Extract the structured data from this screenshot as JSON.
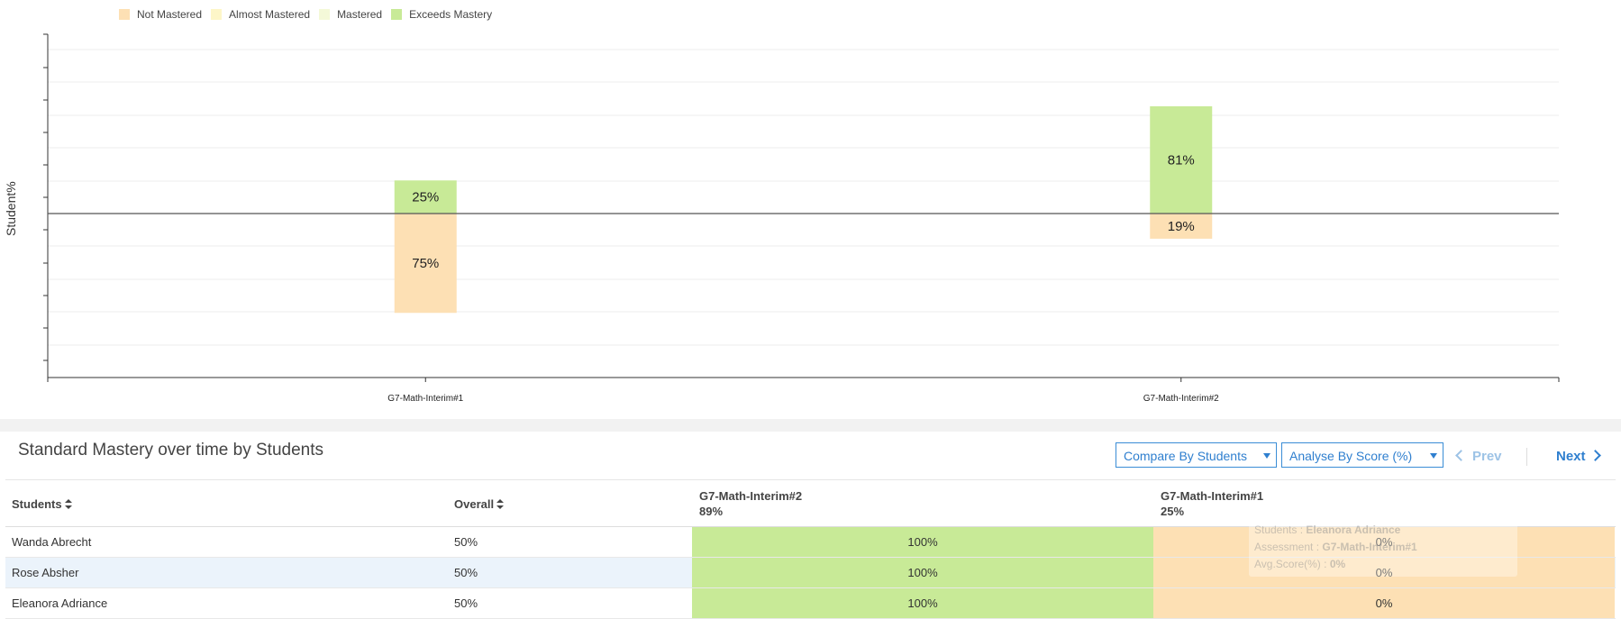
{
  "legend": [
    {
      "label": "Not Mastered",
      "color": "#fde0b4"
    },
    {
      "label": "Almost Mastered",
      "color": "#fdf6c8"
    },
    {
      "label": "Mastered",
      "color": "#f4f9d8"
    },
    {
      "label": "Exceeds Mastery",
      "color": "#c8ea97"
    }
  ],
  "chart_data": {
    "type": "bar",
    "stacked": "diverging",
    "ylabel": "Student%",
    "categories": [
      "G7-Math-Interim#1",
      "G7-Math-Interim#2"
    ],
    "series": [
      {
        "name": "Exceeds Mastery",
        "direction": "up",
        "color": "#c8ea97",
        "values": [
          25,
          81
        ],
        "labels": [
          "25%",
          "81%"
        ]
      },
      {
        "name": "Not Mastered",
        "direction": "down",
        "color": "#fde0b4",
        "values": [
          75,
          19
        ],
        "labels": [
          "75%",
          "19%"
        ]
      }
    ],
    "ylim": [
      -100,
      100
    ],
    "grid": true,
    "legend_position": "top-left"
  },
  "section": {
    "title": "Standard Mastery over time by Students",
    "compare_select": "Compare By Students",
    "analyse_select": "Analyse By Score (%)",
    "prev_label": "Prev",
    "next_label": "Next"
  },
  "table": {
    "headers": {
      "students": "Students",
      "overall": "Overall",
      "col1_name": "G7-Math-Interim#2",
      "col1_score": "89%",
      "col2_name": "G7-Math-Interim#1",
      "col2_score": "25%"
    },
    "rows": [
      {
        "name": "Wanda Abrecht",
        "overall": "50%",
        "s1": "100%",
        "s2": "0%"
      },
      {
        "name": "Rose Absher",
        "overall": "50%",
        "s1": "100%",
        "s2": "0%"
      },
      {
        "name": "Eleanora Adriance",
        "overall": "50%",
        "s1": "100%",
        "s2": "0%"
      }
    ]
  },
  "tooltip": {
    "students_label": "Students :",
    "students_value": "Eleanora Adriance",
    "assessment_label": "Assessment :",
    "assessment_value": "G7-Math-Interim#1",
    "score_label": "Avg.Score(%) :",
    "score_value": "0%"
  }
}
